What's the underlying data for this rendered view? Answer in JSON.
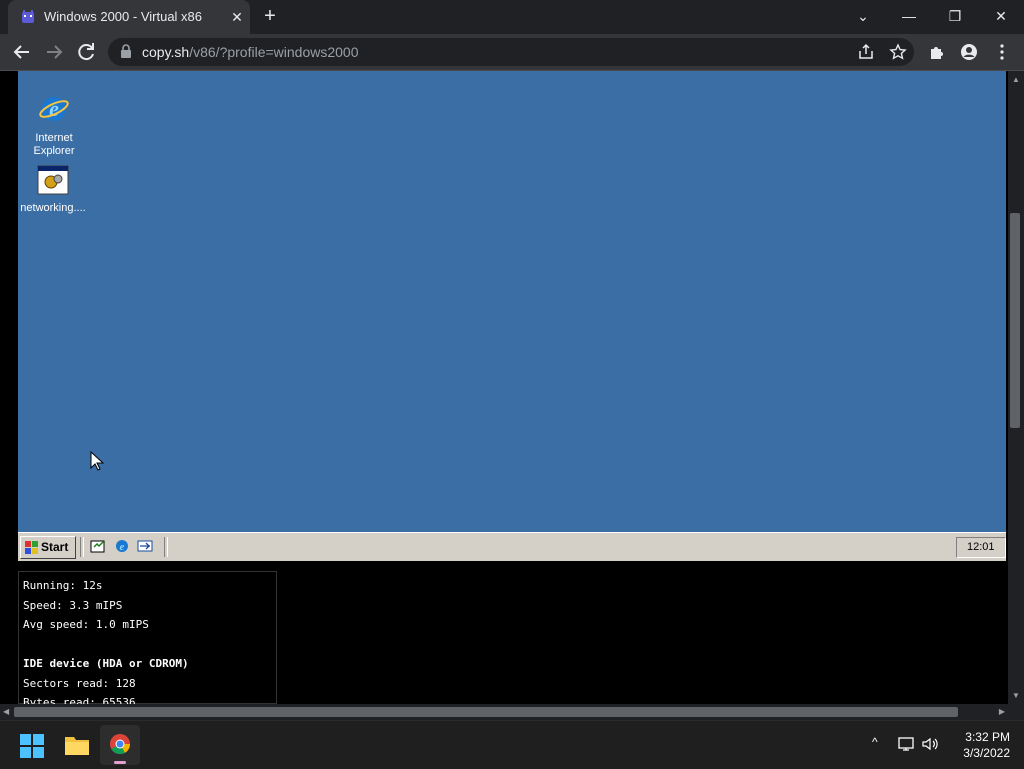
{
  "browser": {
    "tab_title": "Windows 2000 - Virtual x86",
    "url_host": "copy.sh",
    "url_path": "/v86/?profile=windows2000"
  },
  "desktop": {
    "background": "#3a6ea5",
    "icons": [
      {
        "label": "Internet Explorer",
        "icon": "ie-icon"
      },
      {
        "label": "networking....",
        "icon": "networking-icon"
      }
    ]
  },
  "win2k_taskbar": {
    "start_label": "Start",
    "clock": "12:01"
  },
  "stats": {
    "running": "Running: 12s",
    "speed": "Speed: 3.3 mIPS",
    "avg_speed": "Avg speed: 1.0 mIPS",
    "ide_heading": "IDE device (HDA or CDROM)",
    "sectors_read": "Sectors read: 128",
    "bytes_read": "Bytes read: 65536"
  },
  "system": {
    "time": "3:32 PM",
    "date": "3/3/2022"
  }
}
